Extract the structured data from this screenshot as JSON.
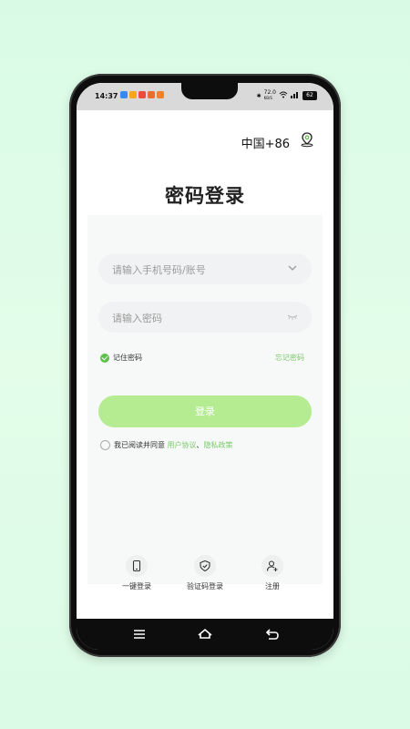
{
  "status_bar": {
    "time": "14:37",
    "speed_value": "72.0",
    "speed_unit": "KB/S",
    "battery": "62"
  },
  "header": {
    "region": "中国+86",
    "location_icon": "location-pin-icon"
  },
  "title": "密码登录",
  "form": {
    "account_placeholder": "请输入手机号码/账号",
    "password_placeholder": "请输入密码",
    "remember_label": "记住密码",
    "forgot_label": "忘记密码",
    "login_label": "登录",
    "agree_prefix": "我已阅读并同意 ",
    "user_agreement": "用户协议",
    "separator": "、",
    "privacy_policy": "隐私政策"
  },
  "alt_logins": [
    {
      "label": "一键登录",
      "icon": "phone-icon"
    },
    {
      "label": "验证码登录",
      "icon": "shield-check-icon"
    },
    {
      "label": "注册",
      "icon": "user-add-icon"
    }
  ],
  "colors": {
    "accent": "#7bc96b",
    "button": "#b5ec92",
    "background": "#dbfbe6"
  }
}
